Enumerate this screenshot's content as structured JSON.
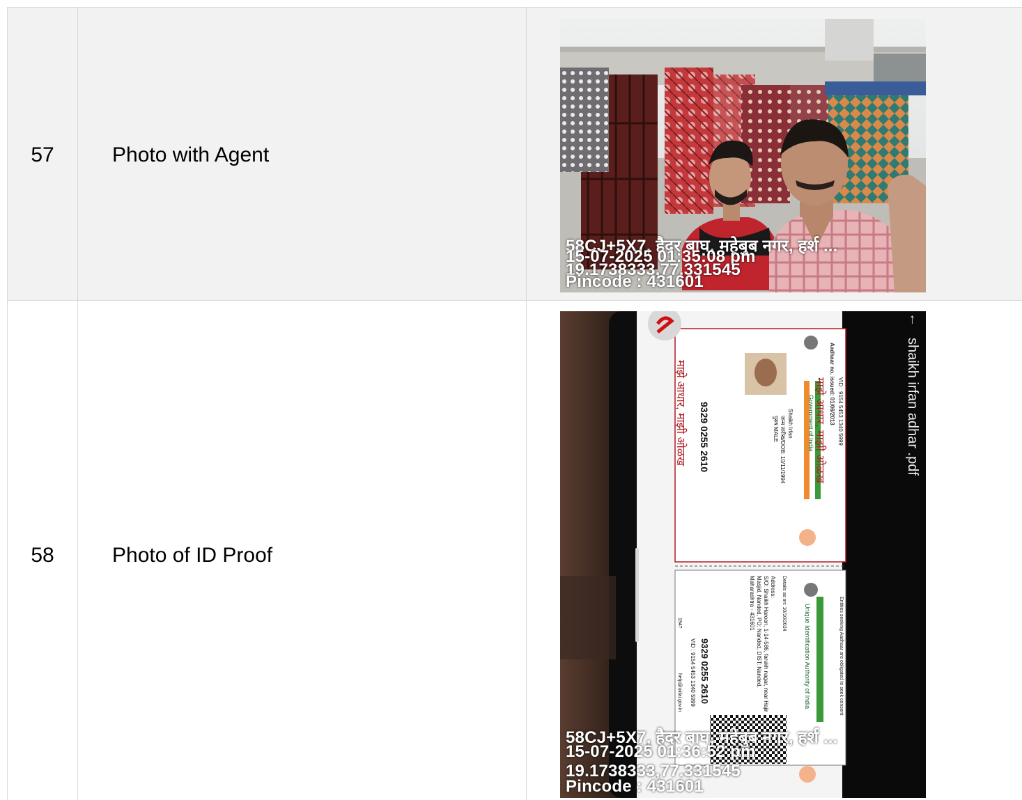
{
  "rows": [
    {
      "number": "57",
      "label": "Photo with Agent",
      "photo": {
        "overlay": [
          "58CJ+5X7, हैदर बाघ, महेबुब नगर, हर्श ...",
          "15-07-2025 01:35:08 pm",
          "19.1738333,77.331545",
          "Pincode : 431601"
        ]
      }
    },
    {
      "number": "58",
      "label": "Photo of ID Proof",
      "photo": {
        "overlay": [
          "58CJ+5X7, हैदर बाघ, महेबुब नगर, हर्श ...",
          "15-07-2025 01:36:52 pm",
          "19.1738333,77.331545",
          "Pincode : 431601"
        ],
        "document": {
          "filename": "shaikh irfan adhar .pdf",
          "issued": "Aadhaar no. issued: 01/06/2013",
          "brand": "माझे आधार, माझी ओळख",
          "vid": "VID : 9154 5453 1340 5999",
          "govt": "Government of India",
          "name": "Shaikh Irfan",
          "dob": "जन्म तारीख/DOB: 10/11/1994",
          "gender": "पुरुष MALE",
          "number": "9329 0255 2610",
          "details": "Details as on: 10/10/2024",
          "address_label": "Address:",
          "address": "S/O: Shaikh Haroon, 1-14-586, farukh nagar, near Hajir Masjid, Nanded, PO: Nanded, DIST: Nanded, Maharashtra - 431601",
          "uidai": "Unique Identification Authority of India",
          "note": "Entities seeking Aadhaar are obligated to seek consent",
          "email": "help@uidai.gov.in",
          "phone": "1947"
        }
      }
    }
  ]
}
